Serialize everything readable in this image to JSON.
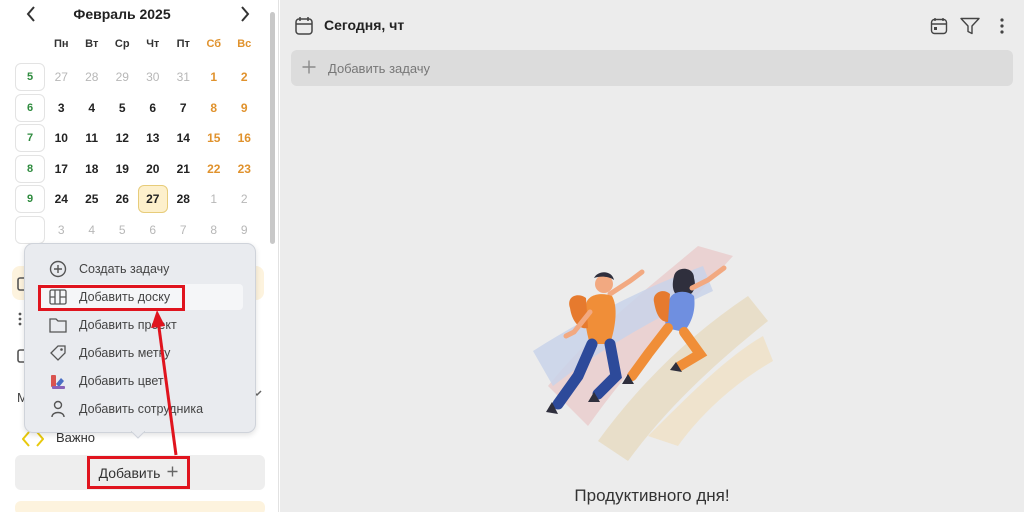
{
  "calendar": {
    "month_title": "Февраль 2025",
    "prev_icon": "chevron-left-icon",
    "next_icon": "chevron-right-icon",
    "weekdays": [
      "Пн",
      "Вт",
      "Ср",
      "Чт",
      "Пт",
      "Сб",
      "Вс"
    ],
    "weeks": [
      {
        "num": "5",
        "days": [
          "27",
          "28",
          "29",
          "30",
          "31",
          "1",
          "2"
        ]
      },
      {
        "num": "6",
        "days": [
          "3",
          "4",
          "5",
          "6",
          "7",
          "8",
          "9"
        ]
      },
      {
        "num": "7",
        "days": [
          "10",
          "11",
          "12",
          "13",
          "14",
          "15",
          "16"
        ]
      },
      {
        "num": "8",
        "days": [
          "17",
          "18",
          "19",
          "20",
          "21",
          "22",
          "23"
        ]
      },
      {
        "num": "9",
        "days": [
          "24",
          "25",
          "26",
          "27",
          "28",
          "1",
          "2"
        ]
      },
      {
        "num": "",
        "days": [
          "3",
          "4",
          "5",
          "6",
          "7",
          "8",
          "9"
        ]
      }
    ],
    "today": "27"
  },
  "sidebar": {
    "tag_label": "Важно",
    "partial_label": "М",
    "add_button_label": "Добавить",
    "add_button_icon": "plus-icon"
  },
  "popup": {
    "items": [
      {
        "label": "Создать задачу",
        "icon": "plus-circle-icon"
      },
      {
        "label": "Добавить доску",
        "icon": "board-icon"
      },
      {
        "label": "Добавить проект",
        "icon": "folder-icon"
      },
      {
        "label": "Добавить метку",
        "icon": "tag-icon"
      },
      {
        "label": "Добавить цвет",
        "icon": "palette-icon"
      },
      {
        "label": "Добавить сотрудника",
        "icon": "person-icon"
      }
    ]
  },
  "main": {
    "title": "Сегодня, чт",
    "add_task_placeholder": "Добавить задачу",
    "greeting": "Продуктивного дня!",
    "toolbar_icons": [
      "calendar-icon",
      "filter-icon",
      "more-vertical-icon"
    ]
  },
  "colors": {
    "accent_orange": "#e0922d",
    "week_green": "#2e8b3e",
    "highlight_red": "#e0141e",
    "today_bg": "#fdf0cc"
  }
}
